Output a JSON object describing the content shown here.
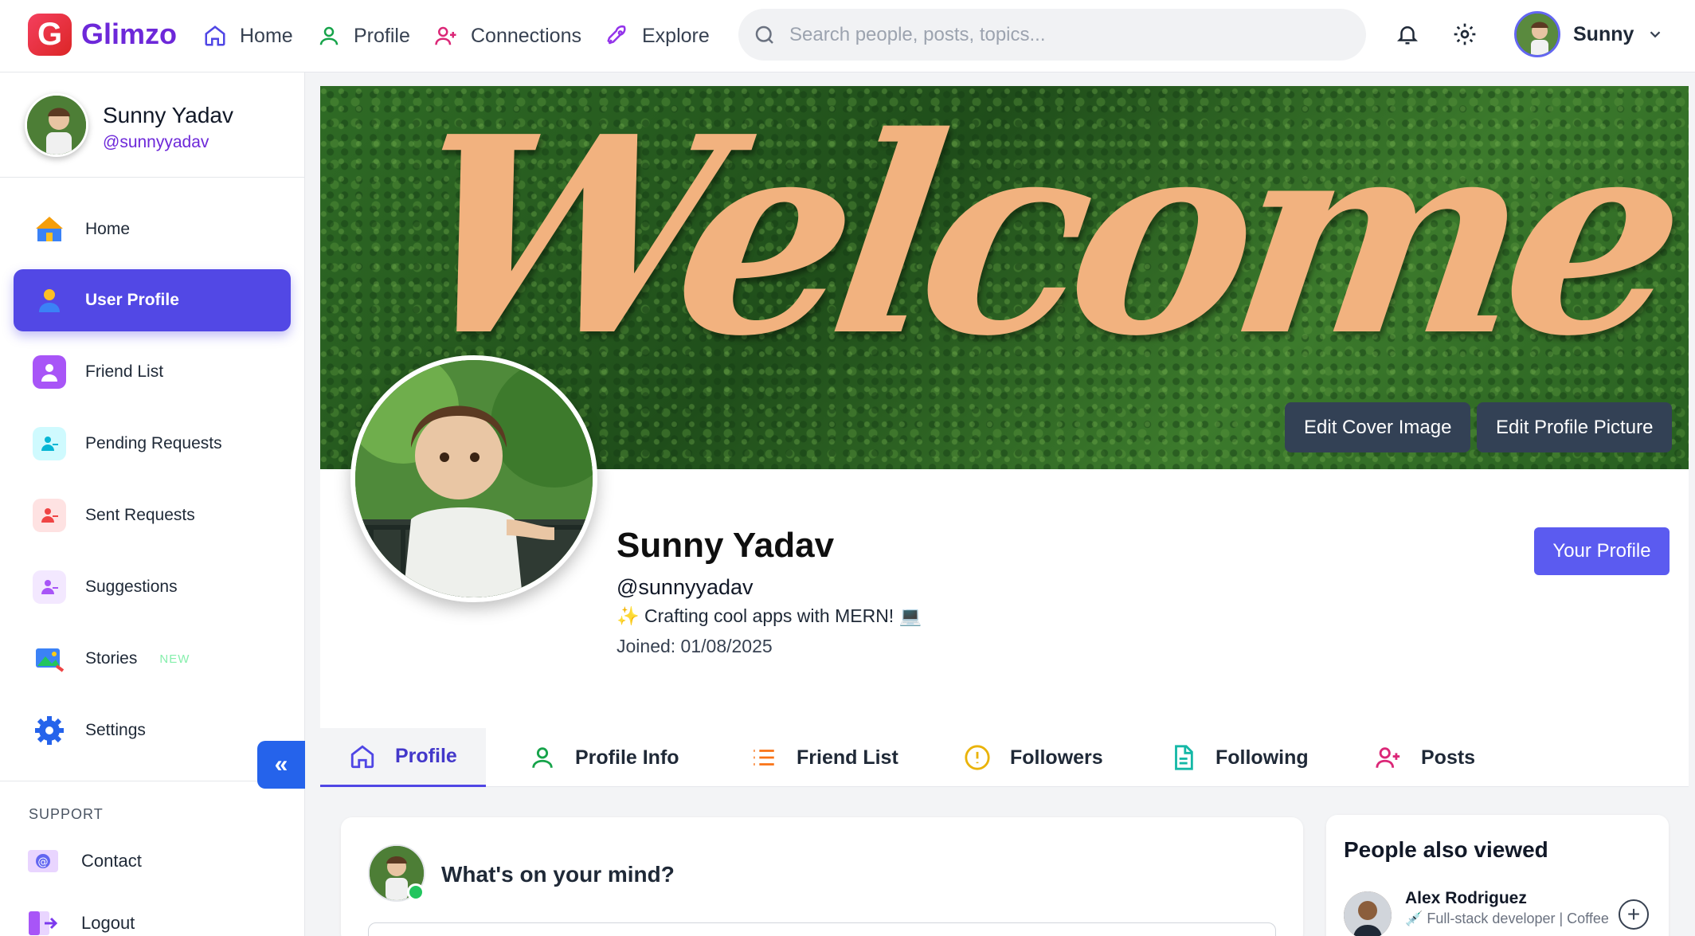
{
  "brand": {
    "name": "Glimzo",
    "logo_letter": "G"
  },
  "nav": [
    {
      "label": "Home",
      "icon": "home-icon"
    },
    {
      "label": "Profile",
      "icon": "user-icon"
    },
    {
      "label": "Connections",
      "icon": "user-plus-icon"
    },
    {
      "label": "Explore",
      "icon": "rocket-icon"
    }
  ],
  "search": {
    "placeholder": "Search people, posts, topics..."
  },
  "current_user": {
    "first_name": "Sunny",
    "name": "Sunny Yadav",
    "handle": "@sunnyyadav"
  },
  "sidebar": {
    "items": [
      {
        "label": "Home",
        "icon": "home-icon"
      },
      {
        "label": "User Profile",
        "icon": "user-icon",
        "active": true
      },
      {
        "label": "Friend List",
        "icon": "friend-list-icon"
      },
      {
        "label": "Pending Requests",
        "icon": "pending-requests-icon"
      },
      {
        "label": "Sent Requests",
        "icon": "sent-requests-icon"
      },
      {
        "label": "Suggestions",
        "icon": "suggestions-icon"
      },
      {
        "label": "Stories",
        "icon": "stories-icon",
        "badge": "NEW"
      },
      {
        "label": "Settings",
        "icon": "gear-icon"
      }
    ],
    "support_label": "SUPPORT",
    "support_items": [
      {
        "label": "Contact",
        "icon": "contact-icon"
      },
      {
        "label": "Logout",
        "icon": "logout-icon"
      }
    ],
    "collapse_glyph": "«"
  },
  "cover": {
    "text": "Welcome",
    "edit_cover_label": "Edit Cover Image",
    "edit_picture_label": "Edit Profile Picture"
  },
  "profile": {
    "name": "Sunny Yadav",
    "handle": "@sunnyyadav",
    "bio": "✨ Crafting cool apps with MERN! 💻",
    "joined": "Joined: 01/08/2025",
    "your_profile_label": "Your Profile"
  },
  "tabs": [
    {
      "label": "Profile",
      "icon": "home-icon",
      "active": true
    },
    {
      "label": "Profile Info",
      "icon": "user-icon"
    },
    {
      "label": "Friend List",
      "icon": "list-icon"
    },
    {
      "label": "Followers",
      "icon": "alert-circle-icon"
    },
    {
      "label": "Following",
      "icon": "document-icon"
    },
    {
      "label": "Posts",
      "icon": "user-plus-icon"
    }
  ],
  "composer": {
    "prompt": "What's on your mind?"
  },
  "people_also_viewed": {
    "title": "People also viewed",
    "people": [
      {
        "name": "Alex Rodriguez",
        "desc": "💉 Full-stack developer | Coffee"
      }
    ]
  },
  "colors": {
    "accent": "#5248e5",
    "brand": "#6d28d9"
  }
}
